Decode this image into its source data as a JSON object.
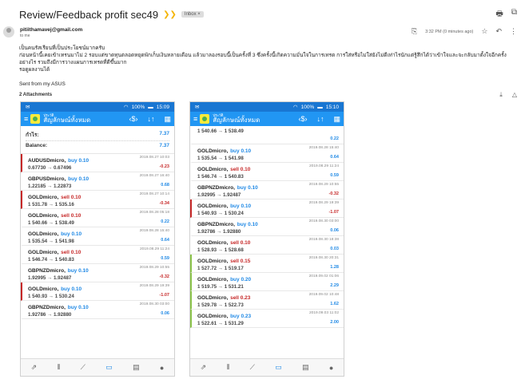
{
  "email": {
    "subject": "Review/Feedback profit sec49",
    "label": "Inbox ×",
    "sender": "pitiithamavej@gmail.com",
    "to": "to me",
    "time": "3:32 PM (0 minutes ago)",
    "body_lines": [
      "เป็นคนรัสเรียนที่เป็นประโยชน์มากครับ",
      "ก่อนหน้านี้เคยเข้าเทรนมาไม่ 2 รอบแต่ขาดทุนตลอดหยุดพักเก็บเงินหลายเดือน แล้วมาลองรอบนี้เป็นครั้งที่ 3 ซึ่งครั้งนี้เกิดความมั่นใจในการเทรด การใส่หรือไม่ใส่ยังไม่ดีเท่าไรนักแต่รู้สึกได้ว่าเข้าใจและจะกลับมาตั้งใจอีกครั้งอย่างไร รวมถึงมีการวางแผนการเทรดที่ดีขึ้นมาก",
      "รอดูผลงานได้",
      "Sent from my ASUS"
    ],
    "attachments_label": "2 Attachments"
  },
  "phones": [
    {
      "status_time": "15:09",
      "battery": "100%",
      "app_sub": "ประวัติ",
      "app_title": "สัญลักษณ์ทั้งหมด",
      "summary": [
        {
          "label": "กำไร:",
          "value": "7.37"
        },
        {
          "label": "Balance:",
          "value": "7.37"
        }
      ],
      "trades": [
        {
          "sym": "AUDUSDmicro,",
          "dir": "buy 0.10",
          "side": "buy",
          "bar": "sell",
          "prices": "0.67730 → 0.67496",
          "date": "2019.08.27 10:03",
          "profit": "-0.23",
          "sign": "neg"
        },
        {
          "sym": "GBPUSDmicro,",
          "dir": "buy 0.10",
          "side": "buy",
          "bar": "buy",
          "prices": "1.22185 → 1.22873",
          "date": "2019.08.27 16:40",
          "profit": "0.68",
          "sign": "pos"
        },
        {
          "sym": "GOLDmicro,",
          "dir": "sell 0.10",
          "side": "sell",
          "bar": "sell",
          "prices": "1 531.78 → 1 535.16",
          "date": "2019.08.27 10:14",
          "profit": "-0.34",
          "sign": "neg"
        },
        {
          "sym": "GOLDmicro,",
          "dir": "sell 0.10",
          "side": "sell",
          "bar": "buy",
          "prices": "1 540.66 → 1 538.49",
          "date": "2019.08.28 05:18",
          "profit": "0.22",
          "sign": "pos"
        },
        {
          "sym": "GOLDmicro,",
          "dir": "buy 0.10",
          "side": "buy",
          "bar": "buy",
          "prices": "1 535.54 → 1 541.98",
          "date": "2019.08.28 15:40",
          "profit": "0.64",
          "sign": "pos"
        },
        {
          "sym": "GOLDmicro,",
          "dir": "sell 0.10",
          "side": "sell",
          "bar": "buy",
          "prices": "1 546.74 → 1 540.83",
          "date": "2019.08.29 11:24",
          "profit": "0.59",
          "sign": "pos"
        },
        {
          "sym": "GBPNZDmicro,",
          "dir": "buy 0.10",
          "side": "buy",
          "bar": "buy",
          "prices": "1.92995 → 1.92487",
          "date": "2019.08.29 10:55",
          "profit": "-0.32",
          "sign": "neg"
        },
        {
          "sym": "GOLDmicro,",
          "dir": "buy 0.10",
          "side": "buy",
          "bar": "sell",
          "prices": "1 540.93 → 1 530.24",
          "date": "2019.08.29 19:39",
          "profit": "-1.07",
          "sign": "neg"
        },
        {
          "sym": "GBPNZDmicro,",
          "dir": "buy 0.10",
          "side": "buy",
          "bar": "buy",
          "prices": "1.92786 → 1.92880",
          "date": "2019.08.30 03:00",
          "profit": "0.06",
          "sign": "pos"
        }
      ]
    },
    {
      "status_time": "15:10",
      "battery": "100%",
      "app_sub": "ประวัติ",
      "app_title": "สัญลักษณ์ทั้งหมด",
      "summary": [],
      "trades": [
        {
          "sym": "",
          "dir": "",
          "side": "buy",
          "bar": "buy",
          "prices": "1 540.66 → 1 538.49",
          "date": "",
          "profit": "0.22",
          "sign": "pos"
        },
        {
          "sym": "GOLDmicro,",
          "dir": "buy 0.10",
          "side": "buy",
          "bar": "buy",
          "prices": "1 535.54 → 1 541.98",
          "date": "2019.08.28 15:40",
          "profit": "0.64",
          "sign": "pos"
        },
        {
          "sym": "GOLDmicro,",
          "dir": "sell 0.10",
          "side": "sell",
          "bar": "buy",
          "prices": "1 546.74 → 1 540.83",
          "date": "2019.08.29 11:24",
          "profit": "0.59",
          "sign": "pos"
        },
        {
          "sym": "GBPNZDmicro,",
          "dir": "buy 0.10",
          "side": "buy",
          "bar": "buy",
          "prices": "1.92995 → 1.92487",
          "date": "2019.08.29 10:55",
          "profit": "-0.32",
          "sign": "neg"
        },
        {
          "sym": "GOLDmicro,",
          "dir": "buy 0.10",
          "side": "buy",
          "bar": "sell",
          "prices": "1 540.93 → 1 530.24",
          "date": "2019.08.29 19:39",
          "profit": "-1.07",
          "sign": "neg"
        },
        {
          "sym": "GBPNZDmicro,",
          "dir": "buy 0.10",
          "side": "buy",
          "bar": "buy",
          "prices": "1.92786 → 1.92880",
          "date": "2019.08.30 03:00",
          "profit": "0.06",
          "sign": "pos"
        },
        {
          "sym": "GOLDmicro,",
          "dir": "sell 0.10",
          "side": "sell",
          "bar": "buy",
          "prices": "1 528.93 → 1 528.68",
          "date": "2019.08.30 18:38",
          "profit": "0.03",
          "sign": "pos"
        },
        {
          "sym": "GOLDmicro,",
          "dir": "sell 0.15",
          "side": "sell",
          "bar": "green",
          "prices": "1 527.72 → 1 519.17",
          "date": "2019.08.30 20:31",
          "profit": "1.28",
          "sign": "pos"
        },
        {
          "sym": "GOLDmicro,",
          "dir": "buy 0.20",
          "side": "buy",
          "bar": "green",
          "prices": "1 519.75 → 1 531.21",
          "date": "2019.09.02 01:06",
          "profit": "2.29",
          "sign": "pos"
        },
        {
          "sym": "GOLDmicro,",
          "dir": "sell 0.23",
          "side": "sell",
          "bar": "green",
          "prices": "1 529.78 → 1 522.73",
          "date": "2019.09.02 10:48",
          "profit": "1.62",
          "sign": "pos"
        },
        {
          "sym": "GOLDmicro,",
          "dir": "buy 0.23",
          "side": "buy",
          "bar": "green",
          "prices": "1 522.61 → 1 531.29",
          "date": "2019.09.03 11:02",
          "profit": "2.00",
          "sign": "pos"
        }
      ]
    }
  ]
}
